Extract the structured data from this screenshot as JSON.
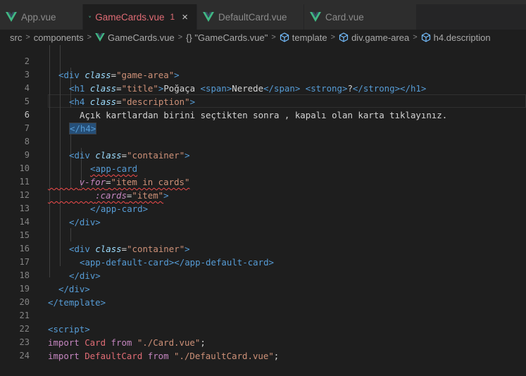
{
  "tabs": [
    {
      "label": "App.vue",
      "active": false
    },
    {
      "label": "GameCards.vue",
      "active": true,
      "badge": "1",
      "close": "×"
    },
    {
      "label": "DefaultCard.vue",
      "active": false
    },
    {
      "label": "Card.vue",
      "active": false
    }
  ],
  "breadcrumb": {
    "items": [
      "src",
      "components",
      "GameCards.vue",
      "{} \"GameCards.vue\"",
      "template",
      "div.game-area",
      "h4.description"
    ],
    "separator": ">"
  },
  "code": {
    "line_numbers": [
      "2",
      "3",
      "4",
      "5",
      "6",
      "7",
      "8",
      "9",
      "10",
      "11",
      "12",
      "13",
      "14",
      "15",
      "16",
      "17",
      "18",
      "19",
      "20",
      "21",
      "22",
      "23",
      "24"
    ],
    "l2": {
      "open": "<div ",
      "attr": "class",
      "eq": "=",
      "val": "\"game-area\"",
      "close": ">"
    },
    "l3": {
      "open": "<h1 ",
      "attr": "class",
      "eq": "=",
      "val": "\"title\"",
      "gt": ">",
      "t1": "Poğaça ",
      "span_open": "<span>",
      "t2": "Nerede",
      "span_close": "</span>",
      "sp": " ",
      "strong_open": "<strong>",
      "t3": "?",
      "strong_close": "</strong>",
      "h1_close": "</h1>"
    },
    "l4": {
      "open": "<h4 ",
      "attr": "class",
      "eq": "=",
      "val": "\"description\"",
      "close": ">"
    },
    "l5": {
      "text": "Açık kartlardan birini seçtikten sonra , kapalı olan karta tıklayınız."
    },
    "l6": {
      "close": "</h4>"
    },
    "l8": {
      "open": "<div ",
      "attr": "class",
      "eq": "=",
      "val": "\"container\"",
      "close": ">"
    },
    "l9": {
      "open": "<app-card"
    },
    "l10": {
      "attr": "v-for",
      "eq": "=",
      "val": "\"item in cards\""
    },
    "l11": {
      "attr": ":cards",
      "eq": "=",
      "val": "\"item\"",
      "close": ">"
    },
    "l12": {
      "close": "</app-card>"
    },
    "l13": {
      "close": "</div>"
    },
    "l15": {
      "open": "<div ",
      "attr": "class",
      "eq": "=",
      "val": "\"container\"",
      "close": ">"
    },
    "l16": {
      "text": "<app-default-card></app-default-card>"
    },
    "l17": {
      "close": "</div>"
    },
    "l18": {
      "close": "</div>"
    },
    "l19": {
      "close": "</template>"
    },
    "l21": {
      "open": "<script>"
    },
    "l22": {
      "kw": "import ",
      "name": "Card",
      "from": " from ",
      "path": "\"./Card.vue\"",
      "semi": ";"
    },
    "l23": {
      "kw": "import ",
      "name": "DefaultCard",
      "from": " from ",
      "path": "\"./DefaultCard.vue\"",
      "semi": ";"
    }
  },
  "colors": {
    "accent_error": "#e06c75",
    "vue_green": "#41b883"
  }
}
